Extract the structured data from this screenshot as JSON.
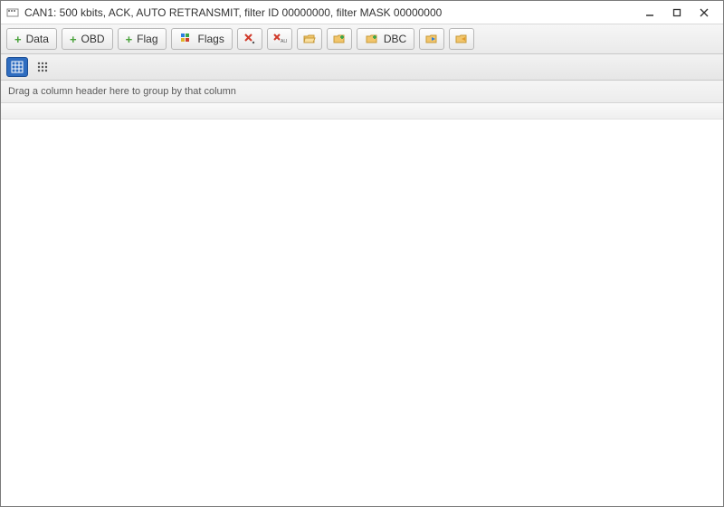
{
  "window": {
    "title": "CAN1: 500 kbits, ACK, AUTO RETRANSMIT, filter ID 00000000, filter MASK 00000000"
  },
  "toolbar": {
    "data_label": "Data",
    "obd_label": "OBD",
    "flag_label": "Flag",
    "flags_label": "Flags",
    "dbc_label": "DBC"
  },
  "grid": {
    "group_hint": "Drag a column header here to group by that column"
  }
}
